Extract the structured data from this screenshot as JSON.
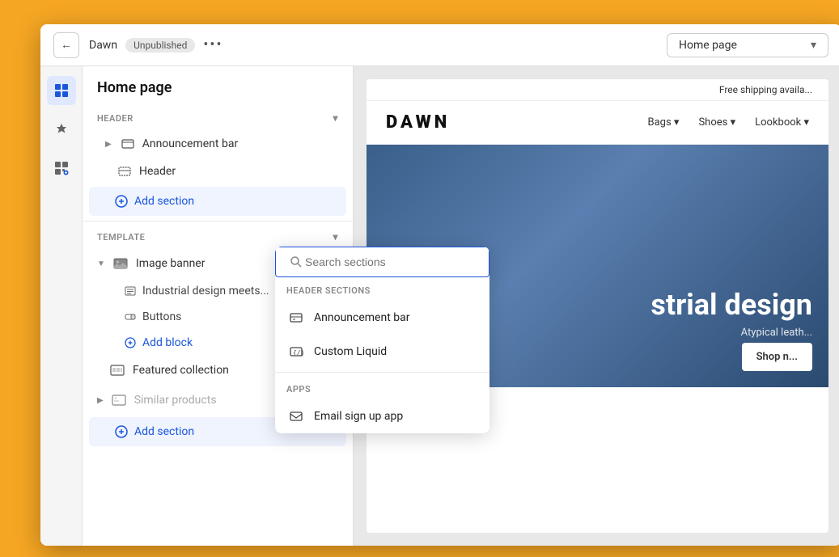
{
  "topbar": {
    "back_button": "←",
    "theme_name": "Dawn",
    "status_badge": "Unpublished",
    "more_options": "•••",
    "page_dropdown": "Home page",
    "dropdown_arrow": "▾"
  },
  "left_panel": {
    "title": "Home page",
    "header_section": {
      "label": "HEADER",
      "items": [
        {
          "name": "Announcement bar",
          "has_expand": true
        },
        {
          "name": "Header",
          "has_expand": false
        }
      ],
      "add_button": "Add section"
    },
    "template_section": {
      "label": "TEMPLATE",
      "items": [
        {
          "name": "Image banner",
          "has_expand": true,
          "children": [
            {
              "name": "Industrial design meets..."
            },
            {
              "name": "Buttons"
            }
          ],
          "add_child": "Add block"
        },
        {
          "name": "Featured collection",
          "has_expand": false
        },
        {
          "name": "Similar products",
          "has_expand": true,
          "hidden": true
        }
      ],
      "add_button": "Add section"
    }
  },
  "search_popup": {
    "placeholder": "Search sections",
    "header_sections_label": "HEADER SECTIONS",
    "header_items": [
      {
        "name": "Announcement bar",
        "icon": "doc-icon"
      },
      {
        "name": "Custom Liquid",
        "icon": "code-icon"
      }
    ],
    "apps_label": "APPS",
    "app_items": [
      {
        "name": "Email sign up app",
        "icon": "email-icon"
      }
    ]
  },
  "preview": {
    "announcement": "Free shipping availa...",
    "logo": "DAWN",
    "nav_items": [
      "Bags ▾",
      "Shoes ▾",
      "Lookbook ▾"
    ],
    "hero_title": "strial design",
    "hero_sub": "Atypical leath...",
    "hero_btn": "Shop n..."
  },
  "icons": {
    "back": "←",
    "sections": "▦",
    "brush": "🖌",
    "blocks": "⊞",
    "search": "🔍",
    "expand": "▶",
    "collapse": "▼",
    "plus_circle": "⊕",
    "chevron_down": "▾",
    "eye_slash": "◌"
  }
}
